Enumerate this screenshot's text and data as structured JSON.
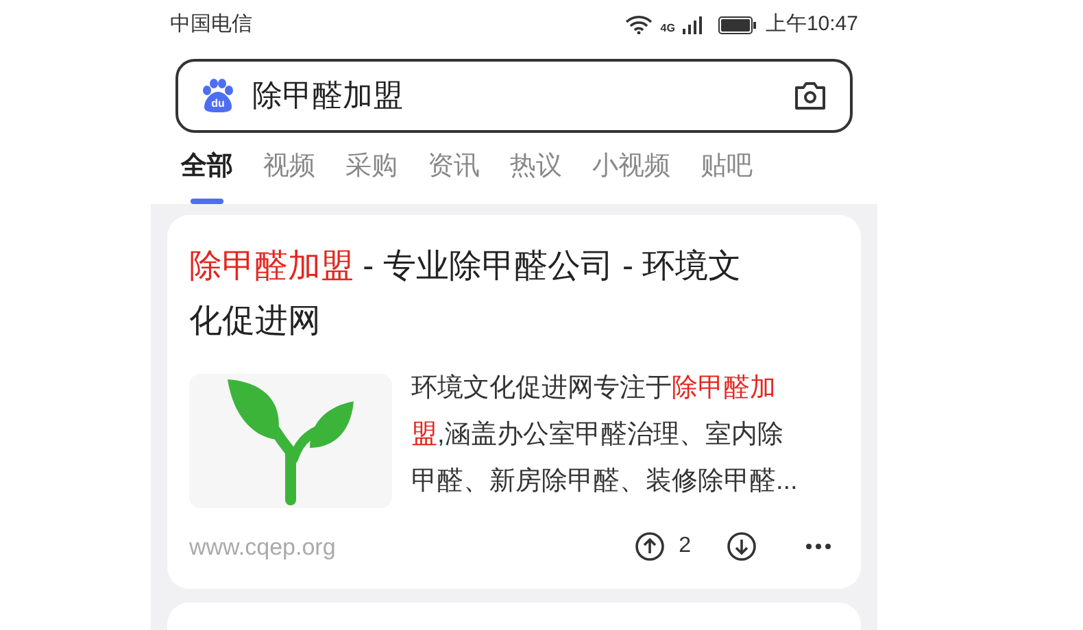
{
  "status_bar": {
    "carrier": "中国电信",
    "network": "4G",
    "time": "上午10:47"
  },
  "search": {
    "logo_text": "du",
    "value": "除甲醛加盟"
  },
  "tabs": [
    {
      "label": "全部",
      "selected": true
    },
    {
      "label": "视频",
      "selected": false
    },
    {
      "label": "采购",
      "selected": false
    },
    {
      "label": "资讯",
      "selected": false
    },
    {
      "label": "热议",
      "selected": false
    },
    {
      "label": "小视频",
      "selected": false
    },
    {
      "label": "贴吧",
      "selected": false
    }
  ],
  "result": {
    "title": [
      {
        "text": "除甲醛加盟",
        "highlight": true
      },
      {
        "text": " - 专业除甲醛公司 - 环境文化促进网",
        "highlight": false
      }
    ],
    "snippet": [
      {
        "text": "环境文化促进网专注于",
        "highlight": false
      },
      {
        "text": "除甲醛加盟",
        "highlight": true
      },
      {
        "text": ",涵盖办公室甲醛治理、室内除甲醛、新房除甲醛、装修除甲醛...",
        "highlight": false
      }
    ],
    "url": "www.cqep.org",
    "upvotes": "2"
  }
}
